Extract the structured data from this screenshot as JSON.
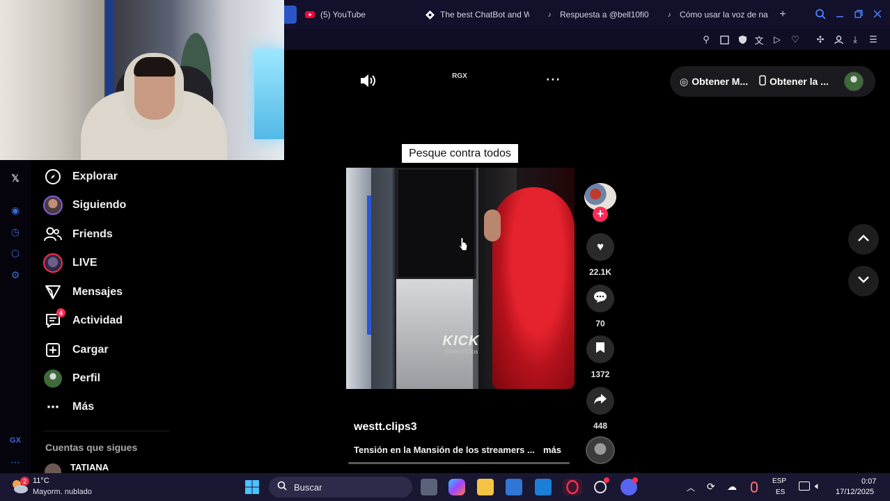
{
  "browser": {
    "tabs": [
      {
        "label": "(5) YouTube",
        "icon": "youtube-icon",
        "color": "#ff0033"
      },
      {
        "label": "The best ChatBot and W",
        "icon": "chatbot-icon",
        "color": "#ffffff"
      },
      {
        "label": "Respuesta a @bell10fi0",
        "icon": "tiktok-icon",
        "color": "#ffffff"
      },
      {
        "label": "Cómo usar la voz de na",
        "icon": "tiktok-icon",
        "color": "#ffffff"
      }
    ],
    "new_tab": "+",
    "accent": "#4d86ff"
  },
  "webcam": {
    "description_label": ""
  },
  "player": {
    "volume_icon": "volume-icon",
    "channel_tag": "RGX",
    "more_icon": "more-icon",
    "get_app_1": "Obtener M...",
    "get_app_2": "Obtener la ...",
    "caption_overlay": "Pesque contra todos",
    "watermark": "KICK",
    "watermark_sub": "@Westt Clips",
    "author": "westt.clips3",
    "description": "Tensión en la Mansión de los streamers ...",
    "more": "más"
  },
  "actions": {
    "likes": "22.1K",
    "comments": "70",
    "saves": "1372",
    "shares": "448"
  },
  "sidebar": {
    "items": [
      {
        "label": "Explorar",
        "icon": "compass-icon"
      },
      {
        "label": "Siguiendo",
        "icon": "following-avatar-icon"
      },
      {
        "label": "Friends",
        "icon": "friends-icon"
      },
      {
        "label": "LIVE",
        "icon": "live-avatar-icon"
      },
      {
        "label": "Mensajes",
        "icon": "messages-icon"
      },
      {
        "label": "Actividad",
        "icon": "activity-icon",
        "badge": "4"
      },
      {
        "label": "Cargar",
        "icon": "upload-icon"
      },
      {
        "label": "Perfil",
        "icon": "profile-avatar-icon"
      },
      {
        "label": "Más",
        "icon": "more-dots-icon"
      }
    ],
    "following_header": "Cuentas que sigues",
    "following_first": "TATIANA"
  },
  "taskbar": {
    "weather_temp": "11°C",
    "weather_desc": "Mayorm. nublado",
    "weather_badge": "2",
    "search_placeholder": "Buscar",
    "lang_top": "ESP",
    "lang_bottom": "ES",
    "time": "0:07",
    "date": "17/12/2025"
  },
  "colors": {
    "tiktok_red": "#fe2c55",
    "taskbar_bg": "#1a1732",
    "tabbar_bg": "#12102a"
  }
}
